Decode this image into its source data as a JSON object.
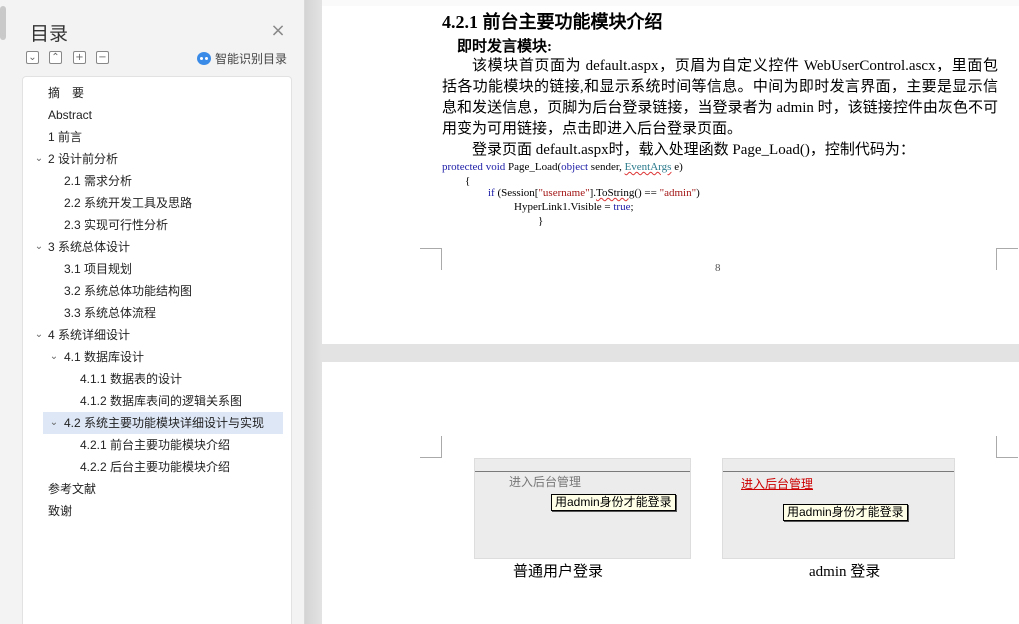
{
  "sidebar": {
    "title": "目录",
    "close_icon": "close-icon",
    "tools": [
      "collapse-all-icon",
      "collapse-level-icon",
      "add-heading-icon",
      "remove-heading-icon"
    ],
    "ai_toc_label": "智能识别目录",
    "items": [
      {
        "label": "摘　要",
        "level": 1,
        "expandable": false,
        "active": false
      },
      {
        "label": "Abstract",
        "level": 1,
        "expandable": false,
        "active": false
      },
      {
        "label": "1  前言",
        "level": 1,
        "expandable": false,
        "active": false
      },
      {
        "label": "2  设计前分析",
        "level": 1,
        "expandable": true,
        "active": false
      },
      {
        "label": "2.1  需求分析",
        "level": 2,
        "expandable": false,
        "active": false
      },
      {
        "label": "2.2  系统开发工具及思路",
        "level": 2,
        "expandable": false,
        "active": false
      },
      {
        "label": "2.3  实现可行性分析",
        "level": 2,
        "expandable": false,
        "active": false
      },
      {
        "label": "3  系统总体设计",
        "level": 1,
        "expandable": true,
        "active": false
      },
      {
        "label": "3.1  项目规划",
        "level": 2,
        "expandable": false,
        "active": false
      },
      {
        "label": "3.2  系统总体功能结构图",
        "level": 2,
        "expandable": false,
        "active": false
      },
      {
        "label": "3.3 系统总体流程",
        "level": 2,
        "expandable": false,
        "active": false
      },
      {
        "label": "4  系统详细设计",
        "level": 1,
        "expandable": true,
        "active": false
      },
      {
        "label": "4.1 数据库设计",
        "level": 2,
        "expandable": true,
        "active": false
      },
      {
        "label": "4.1.1 数据表的设计",
        "level": 3,
        "expandable": false,
        "active": false
      },
      {
        "label": "4.1.2  数据库表间的逻辑关系图",
        "level": 3,
        "expandable": false,
        "active": false
      },
      {
        "label": "4.2 系统主要功能模块详细设计与实现",
        "level": 2,
        "expandable": true,
        "active": true
      },
      {
        "label": "4.2.1  前台主要功能模块介绍",
        "level": 3,
        "expandable": false,
        "active": false
      },
      {
        "label": "4.2.2  后台主要功能模块介绍",
        "level": 3,
        "expandable": false,
        "active": false
      },
      {
        "label": "参考文献",
        "level": 1,
        "expandable": false,
        "active": false
      },
      {
        "label": "致谢",
        "level": 1,
        "expandable": false,
        "active": false
      }
    ]
  },
  "document": {
    "section_heading": "4.2.1  前台主要功能模块介绍",
    "sub_heading": "即时发言模块:",
    "para1": "该模块首页面为 default.aspx，页眉为自定义控件 WebUserControl.ascx，里面包括各功能模块的链接,和显示系统时间等信息。中间为即时发言界面，主要是显示信息和发送信息，页脚为后台登录链接，当登录者为 admin 时，该链接控件由灰色不可用变为可用链接，点击即进入后台登录页面。",
    "para2": "登录页面 default.aspx时，载入处理函数 Page_Load()，控制代码为：",
    "code": {
      "l1_kw1": "protected",
      "l1_kw2": "void",
      "l1_name": " Page_Load(",
      "l1_kw3": "object",
      "l1_mid": " sender, ",
      "l1_type": "EventArgs",
      "l1_end": " e)",
      "l2": "{",
      "l3_kw": "if",
      "l3_a": " (Session[",
      "l3_str1": "\"username\"",
      "l3_b": "].",
      "l3_method": "ToString",
      "l3_c": "() == ",
      "l3_str2": "\"admin\"",
      "l3_d": ")",
      "l4_a": "HyperLink1.Visible = ",
      "l4_kw": "true",
      "l4_b": ";",
      "l5": "}"
    },
    "page_number": "8",
    "figures": [
      {
        "link_label": "进入后台管理",
        "button_label": "用admin身份才能登录",
        "caption": "普通用户登录",
        "link_color": "#777777"
      },
      {
        "link_label": "进入后台管理",
        "button_label": "用admin身份才能登录",
        "caption": "admin 登录",
        "link_color": "#cc0000"
      }
    ]
  }
}
